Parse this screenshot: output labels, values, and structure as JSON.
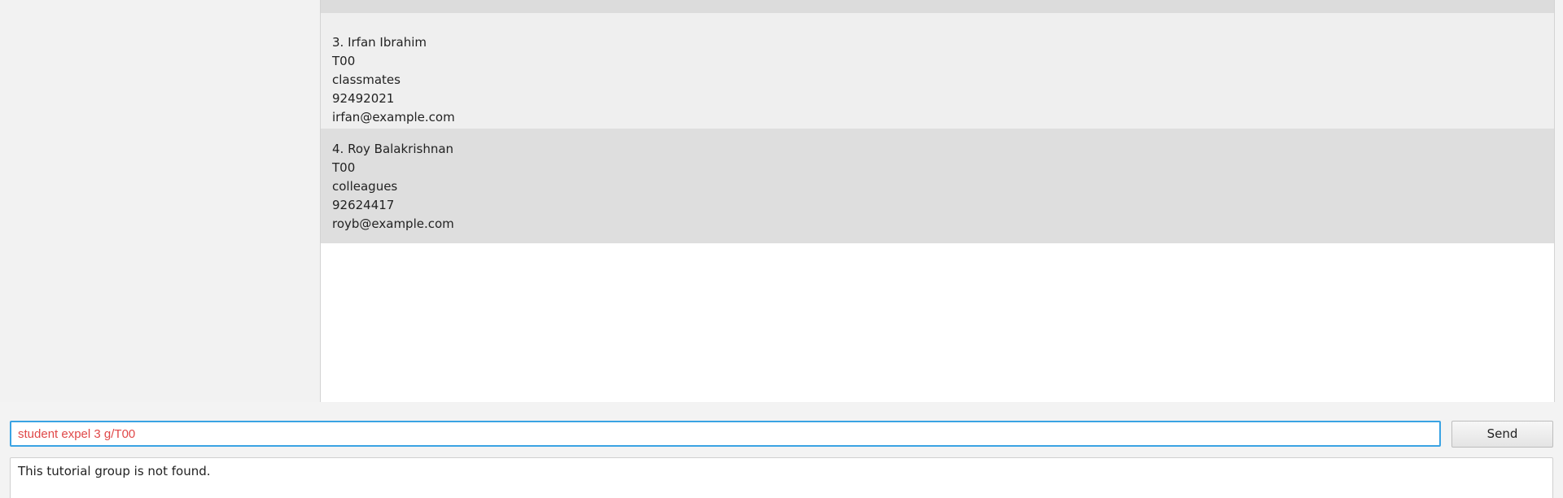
{
  "person_list": {
    "items": [
      {
        "name_line": "3. Irfan Ibrahim",
        "tutorial_group": "T00",
        "tag": "classmates",
        "phone": "92492021",
        "email": "irfan@example.com"
      },
      {
        "name_line": "4. Roy Balakrishnan",
        "tutorial_group": "T00",
        "tag": "colleagues",
        "phone": "92624417",
        "email": "royb@example.com"
      }
    ]
  },
  "command_box": {
    "value": "student expel 3 g/T00"
  },
  "send_button": {
    "label": "Send"
  },
  "result_display": {
    "text": "This tutorial group is not found."
  }
}
